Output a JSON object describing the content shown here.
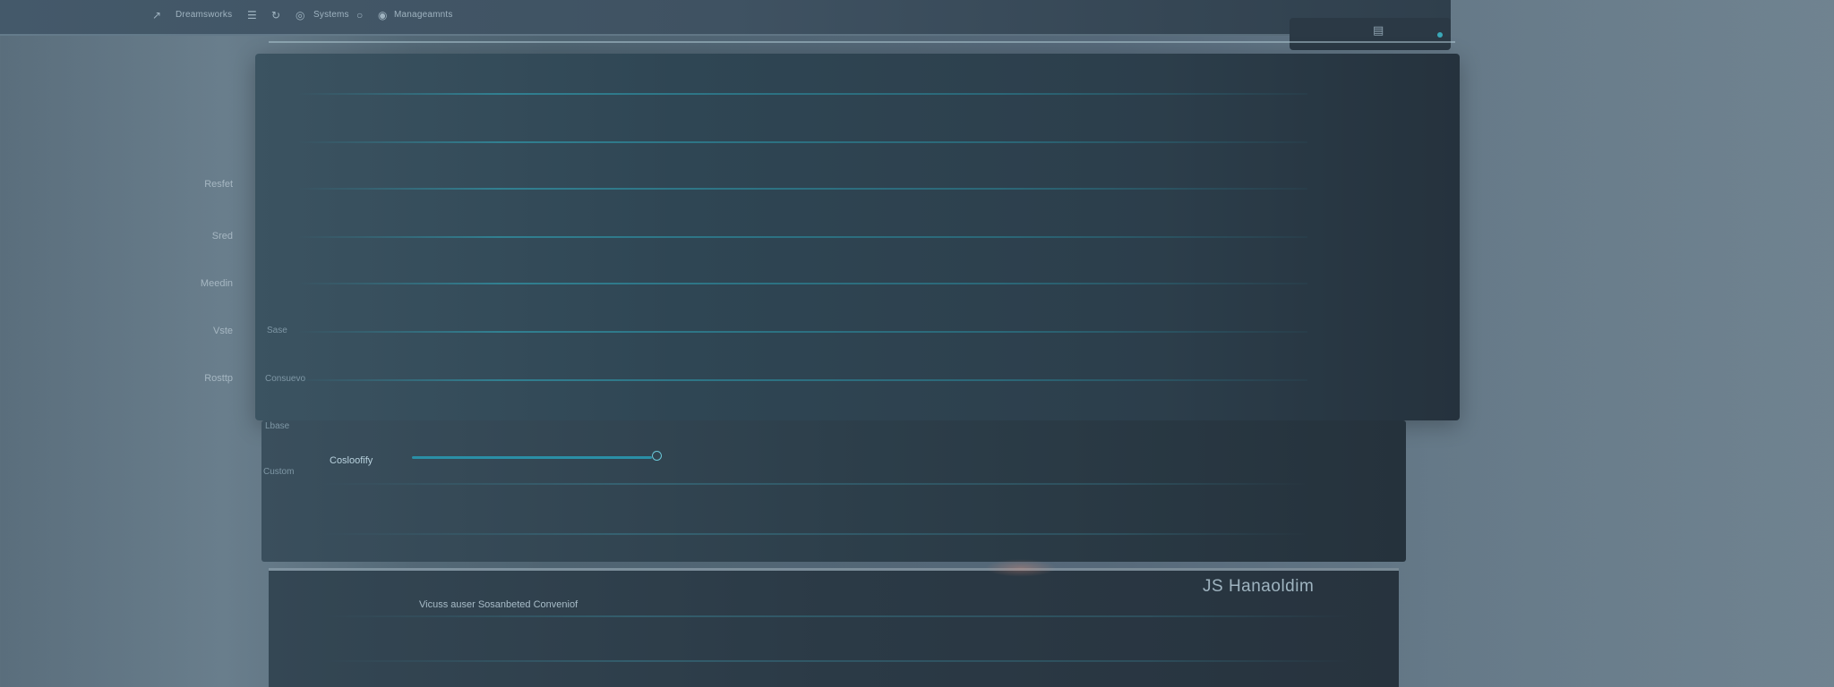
{
  "toolbar": {
    "items": [
      {
        "label": "Dreamsworks",
        "icon": "back-arrow-icon"
      },
      {
        "label": "Systems",
        "icon": "globe-icon"
      },
      {
        "label": "Manageamnts",
        "icon": "user-icon"
      }
    ],
    "menu_icon": "hamburger-menu-icon",
    "refresh_icon": "refresh-icon",
    "right_icon": "document-icon"
  },
  "sidebar": {
    "labels": [
      "Resfet",
      "Sred",
      "Meedin",
      "Vste",
      "Rosttp"
    ]
  },
  "panel": {
    "row_labels": [
      "Sase",
      "Consuevo",
      "Lbase",
      "Custom"
    ]
  },
  "connection": {
    "label": "Cosloofify",
    "level_percent": 100
  },
  "footer": {
    "note": "Vicuss auser Sosanbeted Conveniof",
    "brand": "JS Hanaoldim"
  },
  "colors": {
    "accent": "#2a8fa6",
    "panel": "#2f4654",
    "background": "#56697a"
  }
}
